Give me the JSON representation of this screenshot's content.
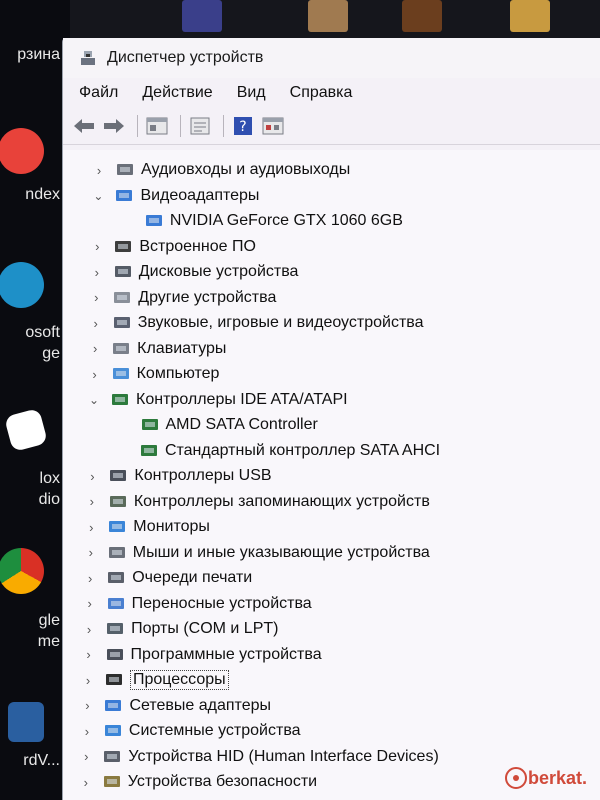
{
  "desktop": {
    "icons": [
      {
        "name": "recycle-bin",
        "label_lines": [
          "рзина"
        ],
        "color": "#5a7ea8"
      },
      {
        "name": "yandex",
        "label_lines": [
          "ndex"
        ],
        "color": "#e8423a"
      },
      {
        "name": "edge",
        "label_lines": [
          "osoft",
          "ge"
        ],
        "color": "#1e90c8"
      },
      {
        "name": "roblox",
        "label_lines": [
          "lox",
          "dio"
        ],
        "color": "#ffffff"
      },
      {
        "name": "chrome",
        "label_lines": [
          "gle",
          "me"
        ],
        "color": "#e8a21a"
      },
      {
        "name": "cardview",
        "label_lines": [
          "rdV..."
        ],
        "color": "#2a5fa0"
      }
    ]
  },
  "window": {
    "title": "Диспетчер устройств",
    "menu": [
      "Файл",
      "Действие",
      "Вид",
      "Справка"
    ],
    "toolbar": [
      "back-arrow",
      "forward-arrow",
      "properties",
      "update-driver",
      "help",
      "show-hidden"
    ]
  },
  "tree": {
    "items": [
      {
        "label": "Аудиовходы и аудиовыходы",
        "level": 0,
        "expanded": false,
        "icon": "speaker-icon"
      },
      {
        "label": "Видеоадаптеры",
        "level": 0,
        "expanded": true,
        "icon": "display-adapter-icon"
      },
      {
        "label": "NVIDIA GeForce GTX 1060 6GB",
        "level": 1,
        "icon": "display-adapter-icon"
      },
      {
        "label": "Встроенное ПО",
        "level": 0,
        "expanded": false,
        "icon": "firmware-icon"
      },
      {
        "label": "Дисковые устройства",
        "level": 0,
        "expanded": false,
        "icon": "disk-icon"
      },
      {
        "label": "Другие устройства",
        "level": 0,
        "expanded": false,
        "icon": "unknown-device-icon"
      },
      {
        "label": "Звуковые, игровые и видеоустройства",
        "level": 0,
        "expanded": false,
        "icon": "sound-icon"
      },
      {
        "label": "Клавиатуры",
        "level": 0,
        "expanded": false,
        "icon": "keyboard-icon"
      },
      {
        "label": "Компьютер",
        "level": 0,
        "expanded": false,
        "icon": "computer-icon"
      },
      {
        "label": "Контроллеры IDE ATA/ATAPI",
        "level": 0,
        "expanded": true,
        "icon": "ide-controller-icon"
      },
      {
        "label": "AMD SATA Controller",
        "level": 1,
        "icon": "ide-controller-icon"
      },
      {
        "label": "Стандартный контроллер SATA AHCI",
        "level": 1,
        "icon": "ide-controller-icon"
      },
      {
        "label": "Контроллеры USB",
        "level": 0,
        "expanded": false,
        "icon": "usb-icon"
      },
      {
        "label": "Контроллеры запоминающих устройств",
        "level": 0,
        "expanded": false,
        "icon": "storage-controller-icon"
      },
      {
        "label": "Мониторы",
        "level": 0,
        "expanded": false,
        "icon": "monitor-icon"
      },
      {
        "label": "Мыши и иные указывающие устройства",
        "level": 0,
        "expanded": false,
        "icon": "mouse-icon"
      },
      {
        "label": "Очереди печати",
        "level": 0,
        "expanded": false,
        "icon": "printer-icon"
      },
      {
        "label": "Переносные устройства",
        "level": 0,
        "expanded": false,
        "icon": "portable-device-icon"
      },
      {
        "label": "Порты (COM и LPT)",
        "level": 0,
        "expanded": false,
        "icon": "port-icon"
      },
      {
        "label": "Программные устройства",
        "level": 0,
        "expanded": false,
        "icon": "software-device-icon"
      },
      {
        "label": "Процессоры",
        "level": 0,
        "expanded": false,
        "icon": "processor-icon",
        "selected": true
      },
      {
        "label": "Сетевые адаптеры",
        "level": 0,
        "expanded": false,
        "icon": "network-adapter-icon"
      },
      {
        "label": "Системные устройства",
        "level": 0,
        "expanded": false,
        "icon": "system-device-icon"
      },
      {
        "label": "Устройства HID (Human Interface Devices)",
        "level": 0,
        "expanded": false,
        "icon": "hid-icon"
      },
      {
        "label": "Устройства безопасности",
        "level": 0,
        "expanded": false,
        "icon": "security-device-icon"
      }
    ]
  },
  "watermark": {
    "text": "berkat."
  }
}
